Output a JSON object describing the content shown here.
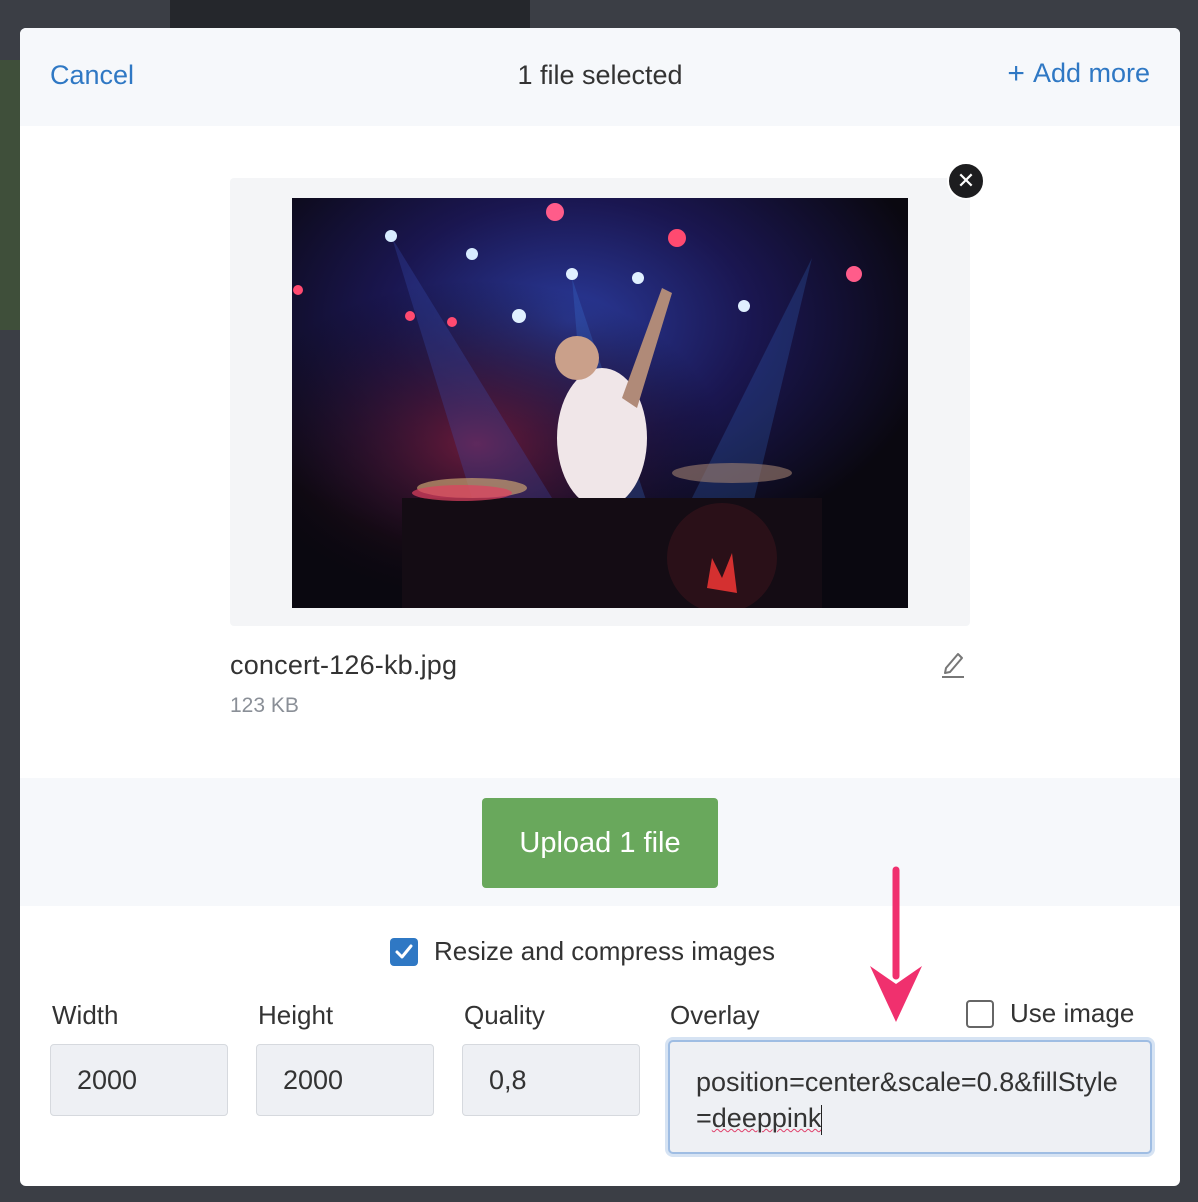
{
  "header": {
    "cancel_label": "Cancel",
    "title": "1 file selected",
    "add_more_label": "Add more",
    "add_more_icon": "plus-icon"
  },
  "file": {
    "name": "concert-126-kb.jpg",
    "size": "123 KB",
    "thumbnail_icon": "concert-photo",
    "remove_icon": "close-icon",
    "edit_icon": "pencil-icon"
  },
  "upload": {
    "label": "Upload 1 file",
    "color": "#69a85c"
  },
  "options": {
    "resize_label": "Resize and compress images",
    "resize_checked": true,
    "width_label": "Width",
    "width_value": "2000",
    "height_label": "Height",
    "height_value": "2000",
    "quality_label": "Quality",
    "quality_value": "0,8",
    "overlay_label": "Overlay",
    "overlay_value_part1": "position=center&scale=0.8&fillSt",
    "overlay_value_part2": "yle=",
    "overlay_value_misspelled": "deeppink",
    "use_image_label": "Use image",
    "use_image_checked": false
  },
  "colors": {
    "link": "#2f78c4",
    "annotation_arrow": "#f0306e"
  }
}
